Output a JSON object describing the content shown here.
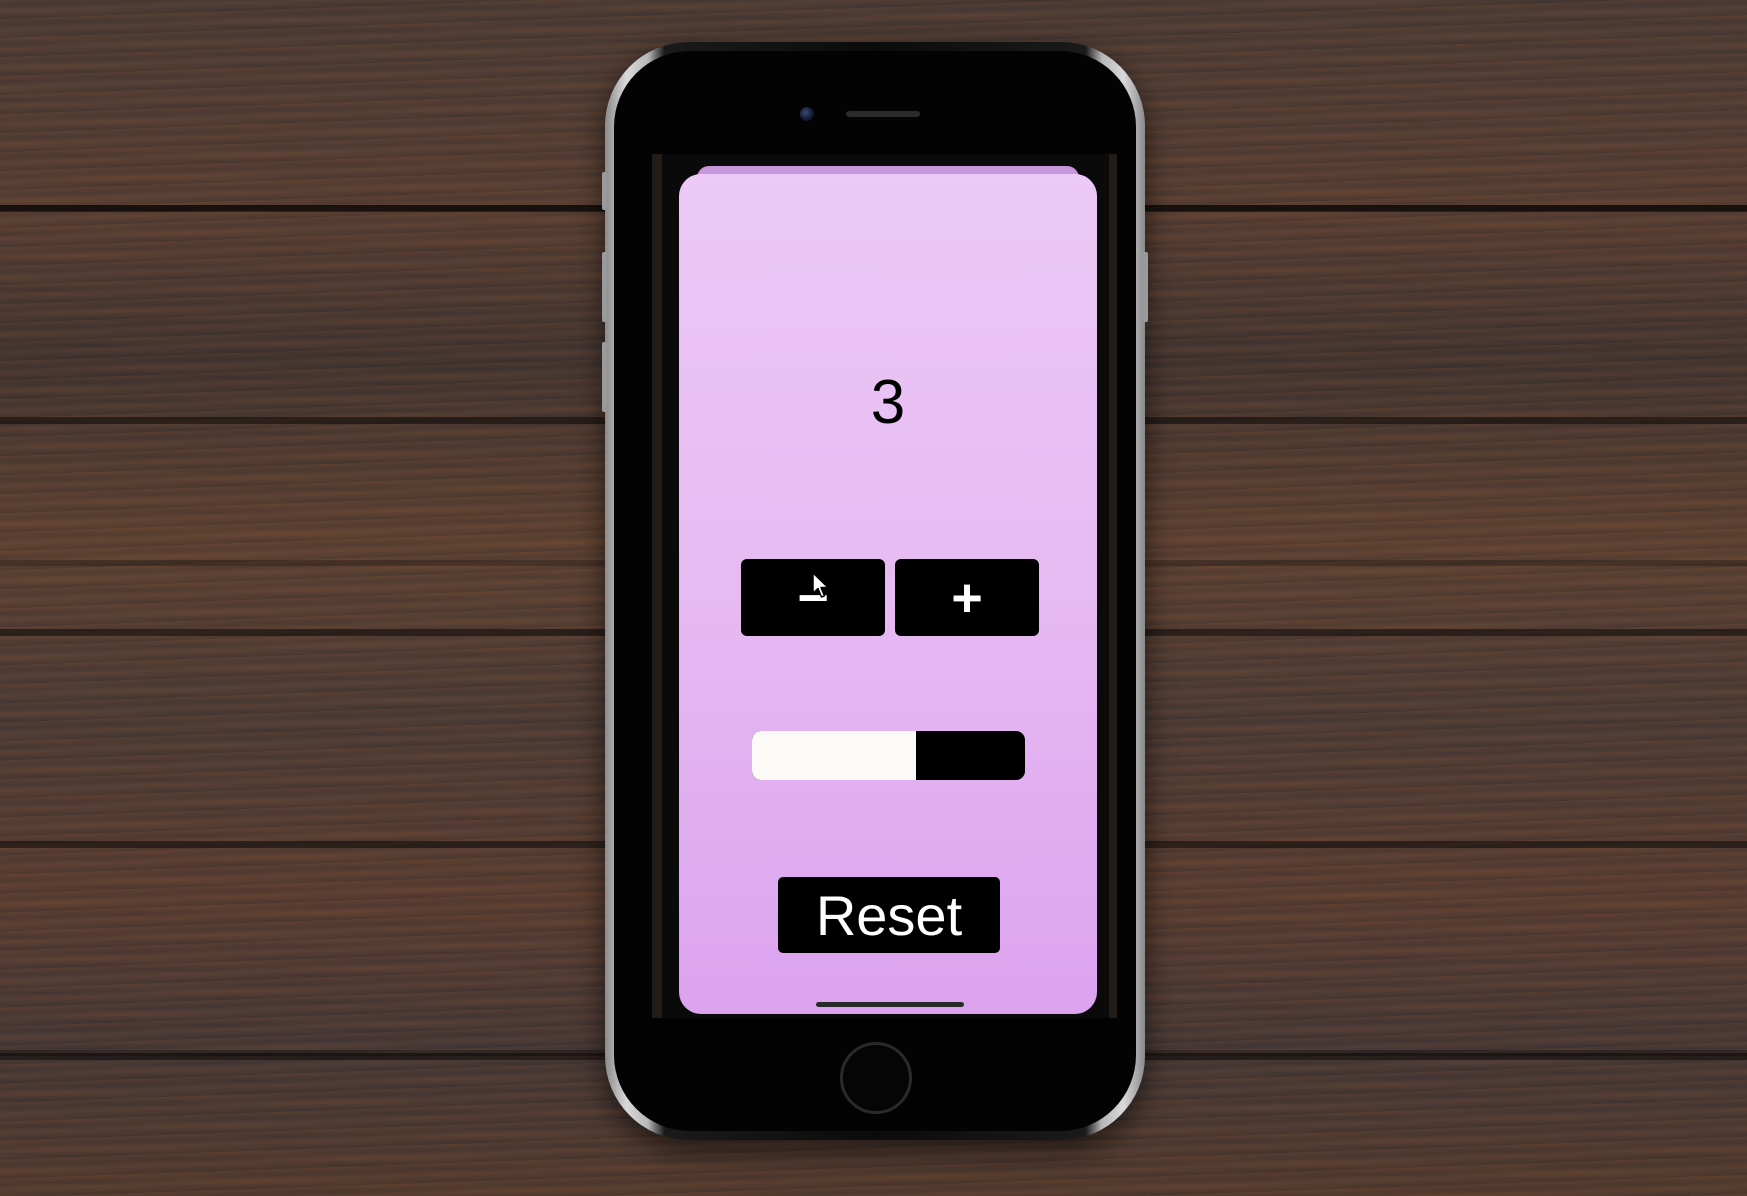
{
  "app": {
    "counter_value": "3",
    "decrement_label": "−",
    "increment_label": "+",
    "reset_label": "Reset",
    "progress_fraction": 0.6
  },
  "icons": {
    "cursor": "mouse-pointer-icon",
    "camera": "front-camera-icon",
    "home": "home-button-icon"
  },
  "colors": {
    "card_top": "#ecc9f6",
    "card_bottom": "#dca3ef",
    "button_bg": "#000000",
    "progress_fill": "#fbfaf7"
  }
}
